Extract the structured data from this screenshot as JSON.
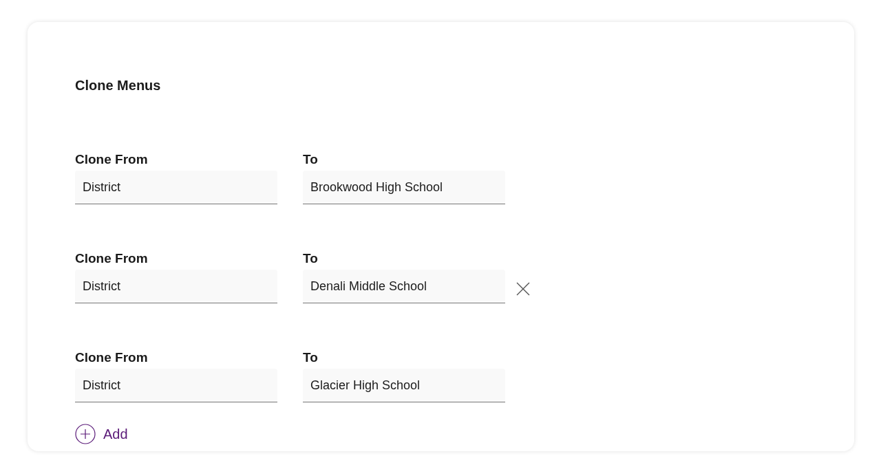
{
  "title": "Clone Menus",
  "rows": [
    {
      "from_label": "Clone From",
      "from_value": "District",
      "to_label": "To",
      "to_value": "Brookwood High School",
      "removable": false
    },
    {
      "from_label": "Clone From",
      "from_value": "District",
      "to_label": "To",
      "to_value": "Denali Middle School",
      "removable": true
    },
    {
      "from_label": "Clone From",
      "from_value": "District",
      "to_label": "To",
      "to_value": "Glacier High School",
      "removable": false
    }
  ],
  "add_button": {
    "label": "Add"
  }
}
